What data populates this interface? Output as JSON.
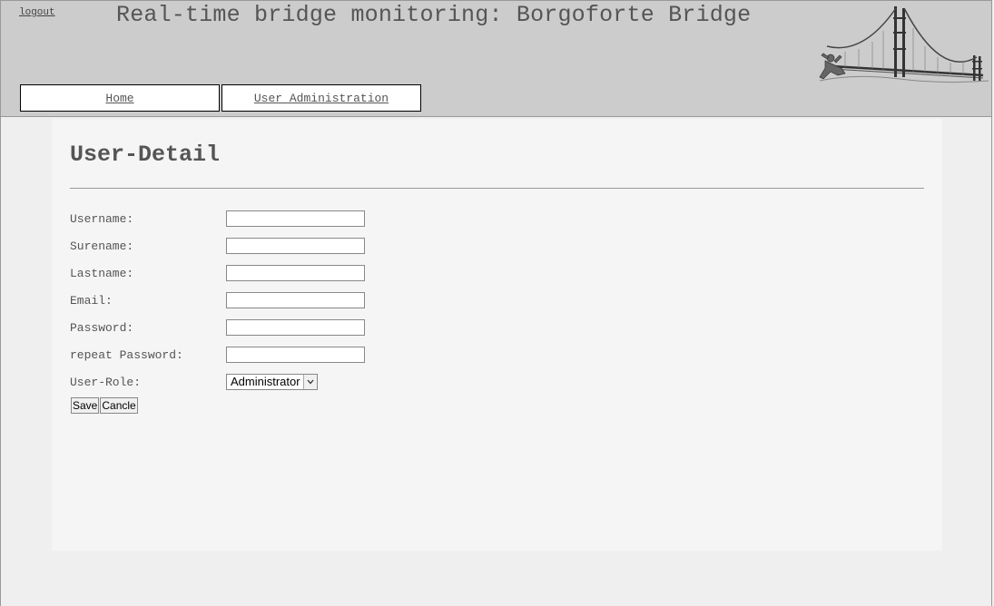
{
  "header": {
    "logout_label": "logout",
    "title": "Real-time bridge monitoring: Borgoforte Bridge"
  },
  "nav": {
    "tabs": [
      {
        "label": "Home"
      },
      {
        "label": "User Administration"
      }
    ]
  },
  "main": {
    "heading": "User-Detail",
    "fields": {
      "username": {
        "label": "Username:",
        "value": ""
      },
      "surename": {
        "label": "Surename:",
        "value": ""
      },
      "lastname": {
        "label": "Lastname:",
        "value": ""
      },
      "email": {
        "label": "Email:",
        "value": ""
      },
      "password": {
        "label": "Password:",
        "value": ""
      },
      "repeat_password": {
        "label": "repeat Password:",
        "value": ""
      },
      "user_role": {
        "label": "User-Role:",
        "selected": "Administrator"
      }
    },
    "buttons": {
      "save_label": "Save",
      "cancel_label": "Cancle"
    }
  },
  "colors": {
    "header_bg": "#cccccc",
    "content_bg": "#f5f5f5",
    "page_bg": "#efefef",
    "text": "#555555"
  },
  "icons": {
    "logo": "golden-gate-bridge-logo",
    "dropdown": "chevron-down-icon"
  }
}
